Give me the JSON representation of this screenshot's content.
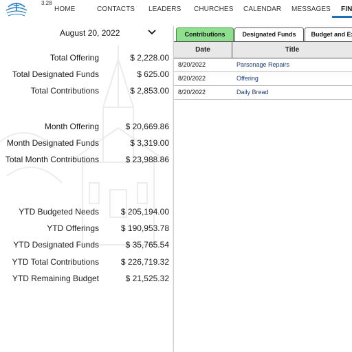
{
  "app": {
    "version": "3.28"
  },
  "nav": {
    "items": [
      {
        "label": "HOME"
      },
      {
        "label": "CONTACTS"
      },
      {
        "label": "LEADERS"
      },
      {
        "label": "CHURCHES"
      },
      {
        "label": "CALENDAR"
      },
      {
        "label": "MESSAGES"
      },
      {
        "label": "FINA",
        "active": true
      }
    ],
    "accent_color": "#1f6fb5"
  },
  "date_picker": {
    "value": "August 20, 2022",
    "icon": "chevron-down-icon"
  },
  "summary": {
    "daily": [
      {
        "label": "Total Offering",
        "value": "$ 2,228.00"
      },
      {
        "label": "Total Designated Funds",
        "value": "$ 625.00"
      },
      {
        "label": "Total Contributions",
        "value": "$ 2,853.00"
      }
    ],
    "month": [
      {
        "label": "Month Offering",
        "value": "$ 20,669.86"
      },
      {
        "label": "Month Designated Funds",
        "value": "$ 3,319.00"
      },
      {
        "label": "Total Month Contributions",
        "value": "$ 23,988.86"
      }
    ],
    "ytd": [
      {
        "label": "YTD Budgeted Needs",
        "value": "$ 205,194.00"
      },
      {
        "label": "YTD Offerings",
        "value": "$ 190,953.78"
      },
      {
        "label": "YTD Designated Funds",
        "value": "$ 35,765.54"
      },
      {
        "label": "YTD Total Contributions",
        "value": "$ 226,719.32"
      },
      {
        "label": "YTD Remaining Budget",
        "value": "$ 21,525.32"
      }
    ]
  },
  "tabs": [
    {
      "label": "Contributions",
      "active": true
    },
    {
      "label": "Designated Funds",
      "active": false
    },
    {
      "label": "Budget and Ex",
      "active": false
    }
  ],
  "tab_active_color": "#8ee08e",
  "table": {
    "columns": [
      "Date",
      "Title"
    ],
    "rows": [
      {
        "date": "8/20/2022",
        "title": "Parsonage Repairs"
      },
      {
        "date": "8/20/2022",
        "title": "Offering"
      },
      {
        "date": "8/20/2022",
        "title": "Daily Bread"
      }
    ],
    "title_link_color": "#1f3d7a"
  }
}
